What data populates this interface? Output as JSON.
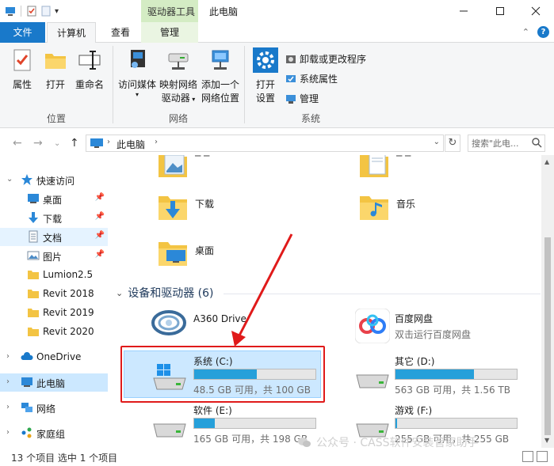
{
  "window": {
    "context_tab": "驱动器工具",
    "title": "此电脑"
  },
  "tabs": {
    "file": "文件",
    "computer": "计算机",
    "view": "查看",
    "manage": "管理"
  },
  "ribbon": {
    "location": {
      "label": "位置",
      "properties": "属性",
      "open": "打开",
      "rename": "重命名"
    },
    "network": {
      "label": "网络",
      "media_line1": "访问媒体",
      "map_line1": "映射网络",
      "map_line2": "驱动器",
      "add_line1": "添加一个",
      "add_line2": "网络位置"
    },
    "system": {
      "label": "系统",
      "settings_line1": "打开",
      "settings_line2": "设置",
      "uninstall": "卸载或更改程序",
      "sysprops": "系统属性",
      "manage": "管理"
    }
  },
  "address": {
    "crumb": "此电脑",
    "search_placeholder": "搜索\"此电..."
  },
  "nav": {
    "quick_access": "快速访问",
    "desktop": "桌面",
    "downloads": "下载",
    "documents": "文档",
    "pictures": "图片",
    "lumion": "Lumion2.5",
    "revit2018": "Revit 2018",
    "revit2019": "Revit 2019",
    "revit2020": "Revit 2020",
    "onedrive": "OneDrive",
    "thispc": "此电脑",
    "network": "网络",
    "homegroup": "家庭组"
  },
  "folders": {
    "downloads": "下载",
    "music": "音乐",
    "desktop": "桌面"
  },
  "devices": {
    "header": "设备和驱动器 (6)",
    "a360": "A360 Drive",
    "baidu_name": "百度网盘",
    "baidu_desc": "双击运行百度网盘",
    "c_name": "系统 (C:)",
    "c_info": "48.5 GB 可用，共 100 GB",
    "c_used": 0.515,
    "d_name": "其它 (D:)",
    "d_info": "563 GB 可用，共 1.56 TB",
    "d_used": 0.65,
    "e_name": "软件 (E:)",
    "e_info": "165 GB 可用，共 198 GB",
    "e_used": 0.17,
    "f_name": "游戏 (F:)",
    "f_info": "255 GB 可用，共 255 GB",
    "f_used": 0.01
  },
  "status": {
    "text": "13 个项目    选中 1 个项目"
  },
  "watermark": "公众号 · CASS软件安装管家助手",
  "colors": {
    "accent": "#1979ca",
    "drive_fill": "#26a0da",
    "selection": "#cce8ff",
    "highlight_red": "#e01a1a"
  }
}
